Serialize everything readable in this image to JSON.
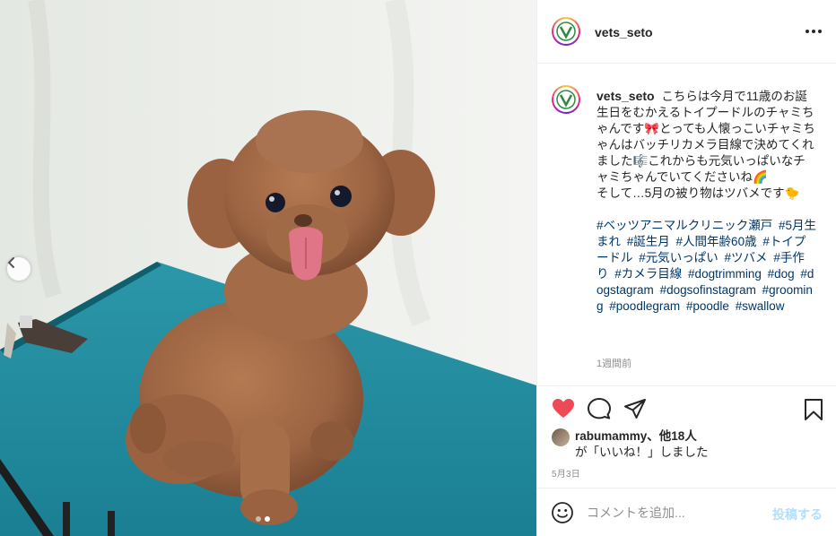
{
  "post": {
    "username": "vets_seto",
    "caption": {
      "lines": [
        "こちらは今月で11歳のお誕生日をむかえるトイプードルのチャミちゃんです🎀とっても人懐っこいチャミちゃんはバッチリカメラ目線で決めてくれました🎼これからも元気いっぱいなチャミちゃんでいてくださいね🌈",
        "そして…5月の被り物はツバメです🐤"
      ],
      "hashtags": [
        "#ベッツアニマルクリニック瀬戸",
        "#5月生まれ",
        "#誕生月",
        "#人間年齢60歳",
        "#トイプードル",
        "#元気いっぱい",
        "#ツバメ",
        "#手作り",
        "#カメラ目線",
        "#dogtrimming",
        "#dog",
        "#dogstagram",
        "#dogsofinstagram",
        "#grooming",
        "#poodlegram",
        "#poodle",
        "#swallow"
      ]
    },
    "time_ago": "1週間前",
    "likes": {
      "first_user": "rabumammy",
      "others": "、他18人",
      "suffix": "が「いいね！」しました"
    },
    "date": "5月3日",
    "comment": {
      "placeholder": "コメントを追加...",
      "post_label": "投稿する"
    },
    "icons": {
      "more": "more-horizontal-icon",
      "like": "heart-icon",
      "comment": "comment-icon",
      "share": "share-icon",
      "save": "bookmark-icon",
      "emoji": "emoji-icon",
      "prev": "chevron-left-icon"
    },
    "colors": {
      "like_active": "#ed4956",
      "hashtag": "#00376b",
      "post_button_disabled": "#b2dffc"
    },
    "carousel": {
      "total": 2,
      "active": 2
    }
  }
}
